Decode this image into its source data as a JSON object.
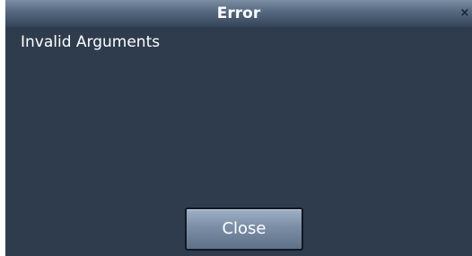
{
  "dialog": {
    "title": "Error",
    "close_glyph": "×",
    "message": "Invalid Arguments",
    "close_button_label": "Close"
  },
  "colors": {
    "background": "#2e3c4e",
    "titlebar": "#55677e",
    "button": "#7b8ea6"
  },
  "icons": {
    "close": "close-icon"
  }
}
